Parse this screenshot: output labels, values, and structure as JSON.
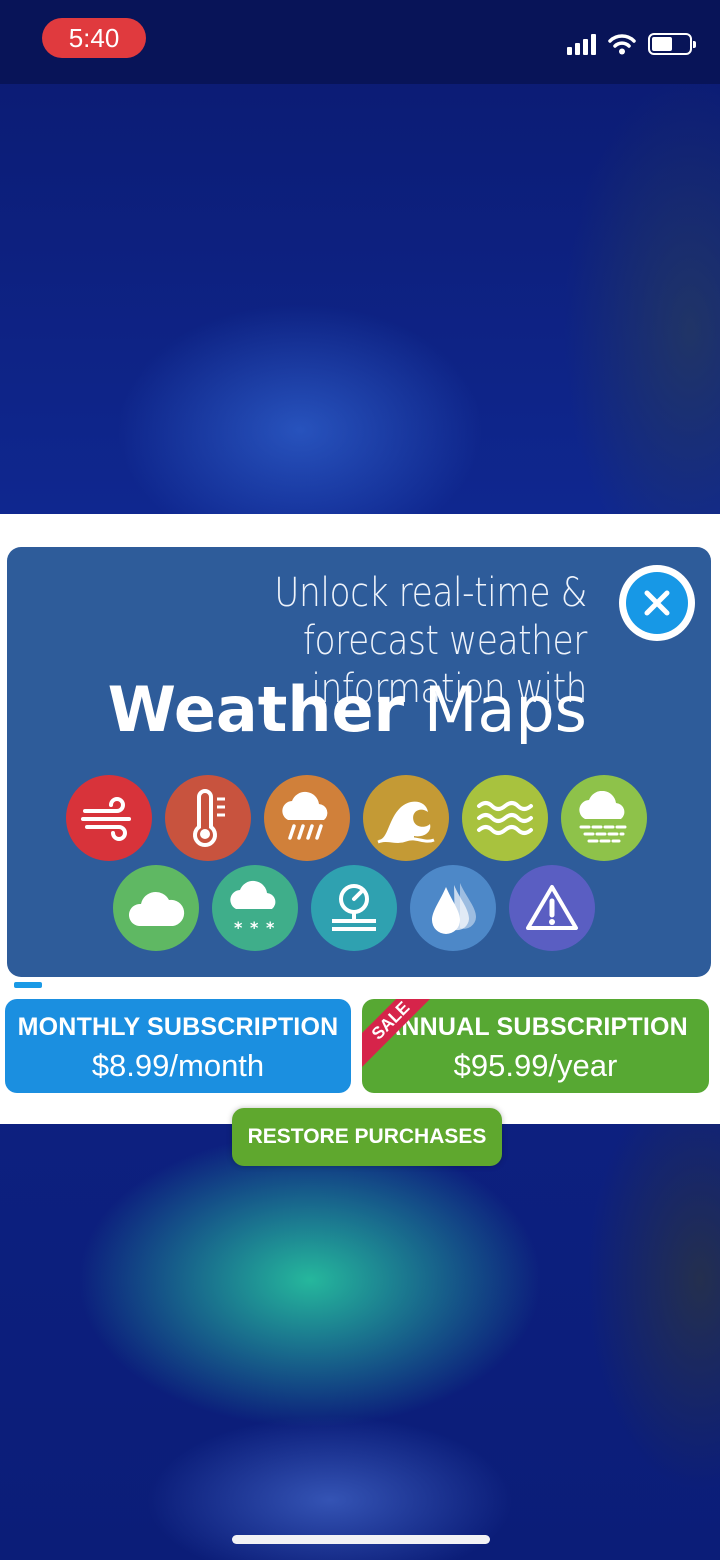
{
  "status_bar": {
    "time": "5:40",
    "time_pill_color": "#e03a3e"
  },
  "promo": {
    "headline": "Unlock real-time & forecast weather information with",
    "brand_bold": "Weather",
    "brand_light": "Maps",
    "close_icon": "close-icon",
    "background_color": "#2e5c9a",
    "icons": [
      {
        "name": "wind-icon",
        "color": "#d8333a"
      },
      {
        "name": "thermometer-icon",
        "color": "#c8533e"
      },
      {
        "name": "rain-cloud-icon",
        "color": "#d0803a"
      },
      {
        "name": "wave-icon",
        "color": "#c49a35"
      },
      {
        "name": "water-waves-icon",
        "color": "#a8c23e"
      },
      {
        "name": "fog-cloud-icon",
        "color": "#8ec24a"
      },
      {
        "name": "cloud-icon",
        "color": "#5fb863"
      },
      {
        "name": "snow-cloud-icon",
        "color": "#3fae8a"
      },
      {
        "name": "pressure-gauge-icon",
        "color": "#2fa1b0"
      },
      {
        "name": "humidity-drops-icon",
        "color": "#4d88c8"
      },
      {
        "name": "warning-icon",
        "color": "#5a5ec2"
      }
    ]
  },
  "subscriptions": {
    "monthly": {
      "label": "MONTHLY SUBSCRIPTION",
      "price": "$8.99/month",
      "color": "#1b8fe0"
    },
    "annual": {
      "label": "ANNUAL SUBSCRIPTION",
      "price": "$95.99/year",
      "badge": "SALE",
      "color": "#57a833"
    }
  },
  "restore": {
    "label": "RESTORE PURCHASES"
  }
}
